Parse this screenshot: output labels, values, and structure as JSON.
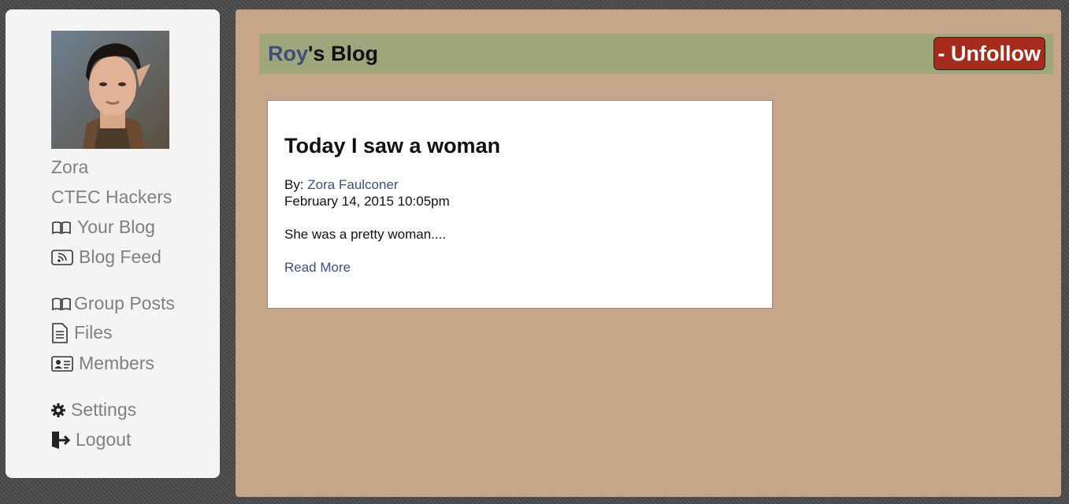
{
  "sidebar": {
    "avatar_alt": "profile portrait",
    "items": [
      {
        "label": "Zora"
      },
      {
        "label": "CTEC Hackers"
      },
      {
        "label": "Your Blog",
        "icon": "open-book-icon"
      },
      {
        "label": "Blog Feed",
        "icon": "rss-feed-icon"
      },
      {
        "label": "Group Posts",
        "icon": "open-book-icon"
      },
      {
        "label": "Files",
        "icon": "document-icon"
      },
      {
        "label": "Members",
        "icon": "id-card-icon"
      },
      {
        "label": "Settings",
        "icon": "gear-icon"
      },
      {
        "label": "Logout",
        "icon": "logout-icon"
      }
    ]
  },
  "header": {
    "owner": "Roy",
    "title_suffix": "'s Blog",
    "unfollow_label": "- Unfollow"
  },
  "post": {
    "title": "Today I saw a woman",
    "by_prefix": "By: ",
    "author": "Zora Faulconer",
    "date": "February 14, 2015 10:05pm",
    "excerpt": "She was a pretty woman....",
    "read_more": "Read More"
  },
  "colors": {
    "page_bg": "#4a4a4a",
    "sidebar_bg": "#f4f4f4",
    "main_bg": "#c6a588",
    "header_bg": "#9fa67c",
    "link": "#3d4f7a",
    "unfollow_bg": "#a52b1d"
  }
}
